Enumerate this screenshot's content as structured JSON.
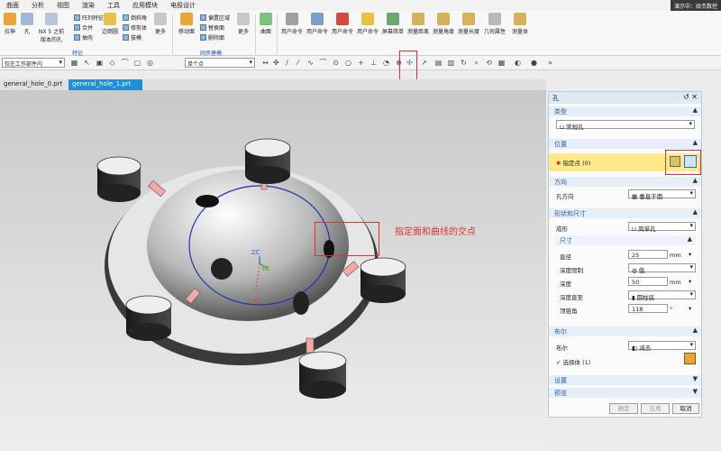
{
  "menu": [
    "曲面",
    "分析",
    "视图",
    "渲染",
    "工具",
    "应用模块",
    "电极设计"
  ],
  "overlay_tag": "演示中：纹杰数控",
  "ribbon": {
    "big_buttons": [
      "拉伸",
      "孔",
      "NX 5 之前版本的孔",
      "边倒圆",
      "更多",
      "移动面",
      "更多",
      "曲面",
      "用户命令",
      "用户命令",
      "用户命令",
      "用户命令",
      "屏幕简单",
      "测量距离",
      "测量角度",
      "测量长度",
      "几何属性",
      "测量体"
    ],
    "small_buttons": [
      "阵列特征",
      "合并",
      "抽壳",
      "倒斜角",
      "修剪体",
      "拔模",
      "偏置区域",
      "替换面",
      "删除面"
    ],
    "group_labels": [
      "特征",
      "同步建模"
    ]
  },
  "toolbar2": {
    "filter": "仅在工作部件内",
    "snap_select": "单个点"
  },
  "tabs": [
    "general_hole_0.prt",
    "general_hole_1.prt"
  ],
  "viewport": {
    "annotation": "指定面和曲线的交点",
    "csys_labels": [
      "ZC",
      "YC",
      "XC"
    ]
  },
  "panel": {
    "title": "孔",
    "sections": {
      "type": "类型",
      "position": "位置",
      "direction": "方向",
      "shape": "形状和尺寸",
      "boolean": "布尔",
      "settings": "设置",
      "preview": "预览"
    },
    "type_value": "常规孔",
    "specify_point": "指定点 (0)",
    "direction_label": "孔方向",
    "direction_value": "垂直于面",
    "form_label": "成形",
    "form_value": "简单孔",
    "dims_label": "尺寸",
    "diameter_label": "直径",
    "diameter_value": "25",
    "diameter_unit": "mm",
    "depth_limit_label": "深度限制",
    "depth_limit_value": "值",
    "depth_label": "深度",
    "depth_value": "50",
    "depth_unit": "mm",
    "depth_to_label": "深度直至",
    "depth_to_value": "圆柱底",
    "tip_angle_label": "顶锥角",
    "tip_angle_value": "118",
    "tip_angle_unit": "°",
    "boolean_label": "布尔",
    "boolean_value": "减去",
    "select_body": "选择体 (1)",
    "ok": "确定",
    "apply": "应用",
    "cancel": "取消"
  },
  "colors": {
    "accent": "#1e8fd6",
    "highlight": "#ffe98a",
    "annotation": "#e0322c"
  }
}
